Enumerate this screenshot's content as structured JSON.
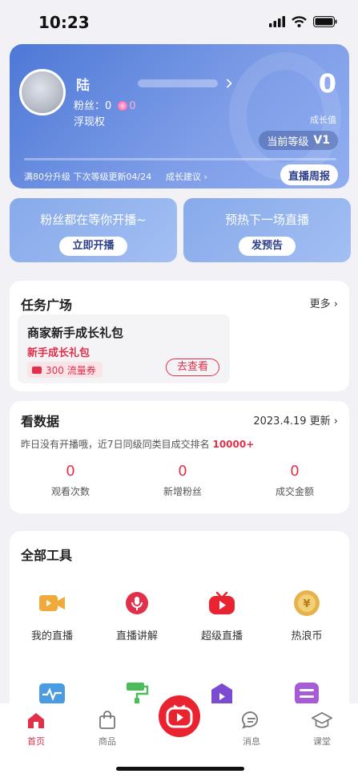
{
  "status_bar": {
    "time": "10:23"
  },
  "profile": {
    "nickname": "陆",
    "fans_label": "粉丝：0",
    "coin_count": "0",
    "float_label": "浮现权",
    "growth_value": "0",
    "growth_label": "成长值",
    "level_label": "当前等级",
    "level_value": "V1",
    "progress": 0,
    "upgrade_text": "满80分升级  下次等级更新04/24",
    "growth_tip": "成长建议 ›",
    "weekly_report": "直播周报"
  },
  "promos": [
    {
      "title": "粉丝都在等你开播~",
      "button": "立即开播"
    },
    {
      "title": "预热下一场直播",
      "button": "发预告"
    }
  ],
  "task_square": {
    "title": "任务广场",
    "more": "更多 ›",
    "task": {
      "name": "商家新手成长礼包",
      "subtitle": "新手成长礼包",
      "coupon": "300 流量券",
      "button": "去查看"
    }
  },
  "data_panel": {
    "title": "看数据",
    "date": "2023.4.19 更新 ›",
    "desc_prefix": "昨日没有开播哦，近7日同级同类目成交排名",
    "desc_rank": "10000+",
    "stats": [
      {
        "value": "0",
        "label": "观看次数"
      },
      {
        "value": "0",
        "label": "新增粉丝"
      },
      {
        "value": "0",
        "label": "成交金额"
      }
    ]
  },
  "tools": {
    "title": "全部工具",
    "items": [
      {
        "label": "我的直播",
        "icon": "video-camera-icon",
        "color": "#f0a93b"
      },
      {
        "label": "直播讲解",
        "icon": "microphone-icon",
        "color": "#e0304a"
      },
      {
        "label": "超级直播",
        "icon": "play-tv-icon",
        "color": "#e9232f"
      },
      {
        "label": "热浪币",
        "icon": "coin-icon",
        "color": "#e6b24a"
      }
    ],
    "row2_icons": [
      {
        "icon": "pulse-icon",
        "color": "#4a9be0"
      },
      {
        "icon": "paint-roller-icon",
        "color": "#4cbb5a"
      },
      {
        "icon": "shop-icon",
        "color": "#7b4bd1"
      },
      {
        "icon": "list-icon",
        "color": "#a75bd6"
      }
    ]
  },
  "tabbar": {
    "items": [
      {
        "label": "首页",
        "icon": "home-icon"
      },
      {
        "label": "商品",
        "icon": "bag-icon"
      },
      {
        "label": "消息",
        "icon": "chat-icon"
      },
      {
        "label": "课堂",
        "icon": "graduation-cap-icon"
      }
    ],
    "center_icon": "live-button-icon"
  },
  "colors": {
    "accent": "#e0304a",
    "brand_blue": "#4d78d6"
  }
}
